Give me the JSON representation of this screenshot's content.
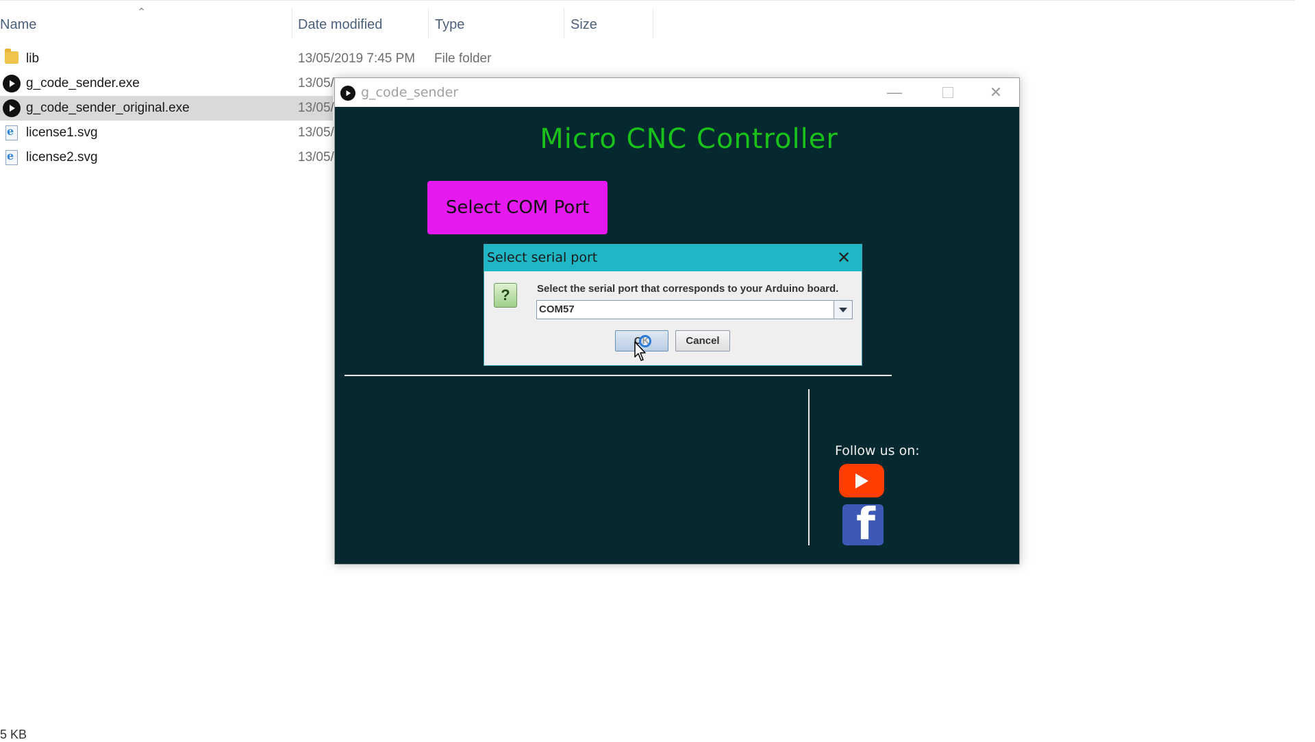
{
  "explorer": {
    "columns": {
      "name": "Name",
      "date_modified": "Date modified",
      "type": "Type",
      "size": "Size"
    },
    "files": [
      {
        "name": "lib",
        "date": "13/05/2019 7:45 PM",
        "type": "File folder",
        "icon": "folder-icon"
      },
      {
        "name": "g_code_sender.exe",
        "date": "13/05/",
        "type": "",
        "icon": "exe-icon"
      },
      {
        "name": "g_code_sender_original.exe",
        "date": "13/05/",
        "type": "",
        "icon": "exe-icon",
        "selected": true
      },
      {
        "name": "license1.svg",
        "date": "13/05/",
        "type": "",
        "icon": "svg-file-icon"
      },
      {
        "name": "license2.svg",
        "date": "13/05/",
        "type": "",
        "icon": "svg-file-icon"
      }
    ],
    "status_size": "5 KB"
  },
  "app_window": {
    "title": "g_code_sender",
    "heading": "Micro CNC Controller",
    "select_com_button": "Select COM Port",
    "follow_label": "Follow us on:",
    "colors": {
      "background": "#06292f",
      "heading": "#19c21b",
      "button": "#e619f0"
    }
  },
  "dialog": {
    "title": "Select serial port",
    "message": "Select the serial port that corresponds to your Arduino board.",
    "selected_port": "COM57",
    "ok_label": "OK",
    "cancel_label": "Cancel",
    "colors": {
      "titlebar": "#1fb6c6"
    }
  }
}
